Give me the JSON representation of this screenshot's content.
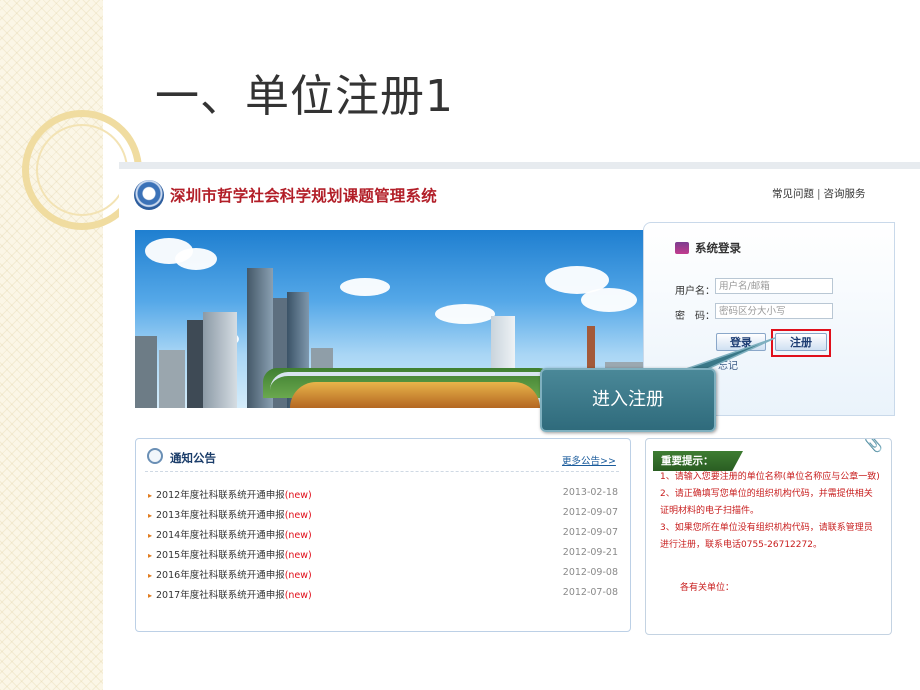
{
  "slide": {
    "title": "一、单位注册1"
  },
  "site": {
    "title": "深圳市哲学社会科学规划课题管理系统",
    "links": [
      "常见问题",
      "咨询服务"
    ],
    "link_separator": "|"
  },
  "login": {
    "header": "系统登录",
    "username_label": "用户名：",
    "username_placeholder": "用户名/邮箱",
    "password_label": "密　码：",
    "password_placeholder": "密码区分大小写",
    "login_button": "登录",
    "register_button": "注册",
    "below_text": "忘记"
  },
  "callout": {
    "text": "进入注册"
  },
  "notice": {
    "title": "通知公告",
    "more": "更多公告>>",
    "items": [
      {
        "title": "2012年度社科联系统开通申报",
        "tag": "(new)",
        "date": "2013-02-18"
      },
      {
        "title": "2013年度社科联系统开通申报",
        "tag": "(new)",
        "date": "2012-09-07"
      },
      {
        "title": "2014年度社科联系统开通申报",
        "tag": "(new)",
        "date": "2012-09-07"
      },
      {
        "title": "2015年度社科联系统开通申报",
        "tag": "(new)",
        "date": "2012-09-21"
      },
      {
        "title": "2016年度社科联系统开通申报",
        "tag": "(new)",
        "date": "2012-09-08"
      },
      {
        "title": "2017年度社科联系统开通申报",
        "tag": "(new)",
        "date": "2012-07-08"
      }
    ]
  },
  "tips": {
    "header": "重要提示：",
    "lines": [
      "1、请输入您要注册的单位名称(单位名称应与公章一致)",
      "2、请正确填写您单位的组织机构代码，并需提供相关证明材料的电子扫描件。",
      "3、如果您所在单位没有组织机构代码，请联系管理员进行注册，联系电话0755-26712272。"
    ],
    "footer": "各有关单位："
  },
  "colors": {
    "site_title": "#b21e28",
    "callout_bg": "#3a7888",
    "highlight_border": "#e0101b",
    "tips_text": "#c81e1e",
    "tips_header_bg": "#2f6b27"
  }
}
